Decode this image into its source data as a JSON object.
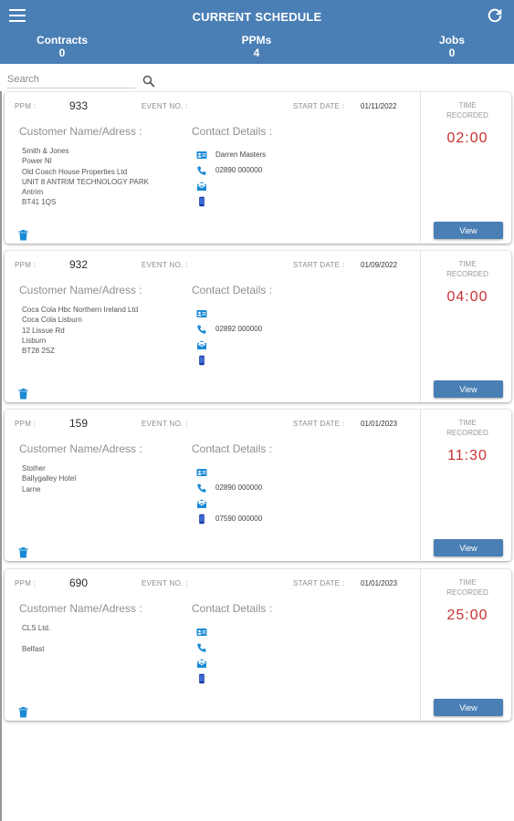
{
  "header": {
    "title": "CURRENT SCHEDULE",
    "counts": [
      {
        "label": "Contracts",
        "value": "0"
      },
      {
        "label": "PPMs",
        "value": "4"
      },
      {
        "label": "Jobs",
        "value": "0"
      }
    ]
  },
  "search": {
    "placeholder": "Search"
  },
  "labels": {
    "ppm": "PPM :",
    "event": "EVENT NO. :",
    "start_date": "START DATE :",
    "customer": "Customer Name/Adress :",
    "contact": "Contact Details :",
    "time_recorded_1": "TIME",
    "time_recorded_2": "RECORDED",
    "view": "View"
  },
  "cards": [
    {
      "ppm": "933",
      "event": "",
      "start_date": "01/11/2022",
      "address": [
        "Smith & Jones",
        "Power NI",
        "Old Coach House Properties Ltd",
        "UNIT 8 ANTRIM TECHNOLOGY PARK",
        "Antrim",
        "BT41 1QS"
      ],
      "contact_name": "Darren Masters",
      "phone": "02890 000000",
      "email": "",
      "mobile": "",
      "time": "02:00"
    },
    {
      "ppm": "932",
      "event": "",
      "start_date": "01/09/2022",
      "address": [
        "Coca Cola Hbc Northern Ireland Ltd",
        "Coca Cola Lisburn",
        "12 Lissue Rd",
        "Lisburn",
        "BT28 2SZ"
      ],
      "contact_name": "",
      "phone": "02892 000000",
      "email": "",
      "mobile": "",
      "time": "04:00"
    },
    {
      "ppm": "159",
      "event": "",
      "start_date": "01/01/2023",
      "address": [
        "Stother",
        "Ballygalley Hotel",
        "Larne"
      ],
      "contact_name": "",
      "phone": "02890 000000",
      "email": "",
      "mobile": "07590 000000",
      "time": "11:30"
    },
    {
      "ppm": "690",
      "event": "",
      "start_date": "01/01/2023",
      "address": [
        "CLS Ltd.",
        "",
        "Belfast"
      ],
      "contact_name": "",
      "phone": "",
      "email": "",
      "mobile": "",
      "time": "25:00"
    }
  ],
  "icons": {
    "menu": "hamburger-menu-icon",
    "refresh": "refresh-icon",
    "search": "search-icon",
    "contact_card": "contact-card-icon",
    "phone": "phone-icon",
    "email": "email-icon",
    "mobile": "mobile-icon",
    "delete": "trash-icon"
  },
  "colors": {
    "header": "#4a7fb5",
    "button": "#4a7fb5",
    "time": "#c83131",
    "icon": "#1a8ad6"
  }
}
